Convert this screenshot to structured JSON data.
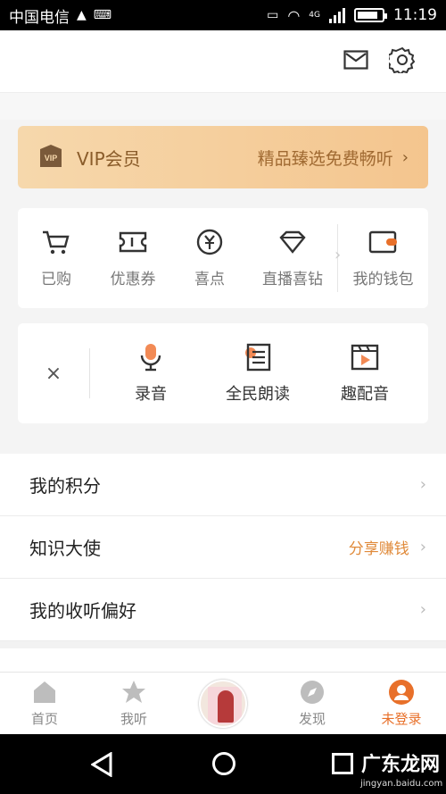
{
  "status_bar": {
    "carrier": "中国电信",
    "network": "4G",
    "time": "11:19",
    "battery_level": 0.85
  },
  "header": {
    "mail_icon": "mail-icon",
    "settings_icon": "gear-icon"
  },
  "vip": {
    "badge": "VIP",
    "title": "VIP会员",
    "slogan": "精品臻选免费畅听",
    "chevron": "›"
  },
  "wallet": {
    "items": [
      {
        "label": "已购",
        "icon": "cart-icon"
      },
      {
        "label": "优惠券",
        "icon": "coupon-icon"
      },
      {
        "label": "喜点",
        "icon": "yen-coin-icon"
      },
      {
        "label": "直播喜钻",
        "icon": "diamond-icon"
      },
      {
        "label": "我的钱包",
        "icon": "wallet-icon"
      }
    ]
  },
  "create": {
    "close": "×",
    "items": [
      {
        "label": "录音",
        "icon": "microphone-icon"
      },
      {
        "label": "全民朗读",
        "icon": "read-document-icon"
      },
      {
        "label": "趣配音",
        "icon": "video-dub-icon"
      }
    ]
  },
  "list": {
    "points": "我的积分",
    "ambassador": "知识大使",
    "ambassador_extra": "分享赚钱",
    "preference": "我的收听偏好",
    "arrow": "›"
  },
  "tabbar": {
    "tabs": [
      {
        "label": "首页",
        "icon": "home-icon"
      },
      {
        "label": "我听",
        "icon": "star-icon"
      },
      {
        "label": "",
        "icon": "now-playing-cover"
      },
      {
        "label": "发现",
        "icon": "compass-icon"
      },
      {
        "label": "未登录",
        "icon": "user-avatar-icon",
        "active": true
      }
    ]
  },
  "watermark": {
    "text": "广东龙网",
    "sub": "jingyan.baidu.com"
  },
  "colors": {
    "accent": "#e8702a",
    "vip_gold": "#f4c58e"
  }
}
